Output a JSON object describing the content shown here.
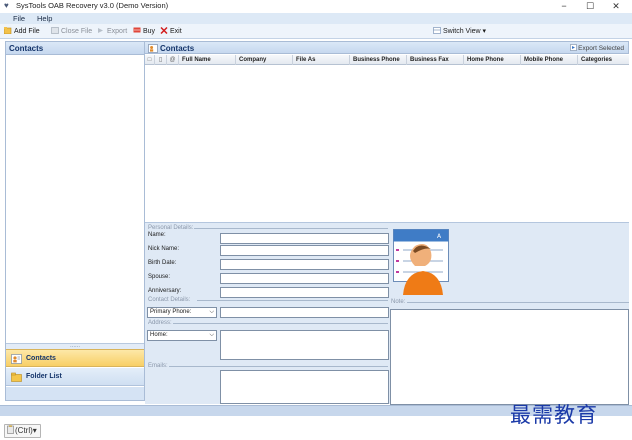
{
  "window": {
    "title": "SysTools OAB Recovery v3.0 (Demo Version)",
    "app_icon": "heart-icon",
    "minimize": "−",
    "maximize": "☐",
    "close": "✕"
  },
  "menu": [
    "File",
    "Help"
  ],
  "toolbar": {
    "add_file": "Add File",
    "close_file": "Close File",
    "export": "Export",
    "buy": "Buy",
    "exit": "Exit",
    "switch_view": "Switch View"
  },
  "left_panel": {
    "title": "Contacts",
    "splitter": "......",
    "nav": [
      {
        "label": "Contacts",
        "icon": "contacts-icon",
        "selected": true
      },
      {
        "label": "Folder List",
        "icon": "folder-icon",
        "selected": false
      }
    ]
  },
  "main": {
    "title": "Contacts",
    "export_selected": "Export Selected",
    "columns": [
      "Full Name",
      "Company",
      "File As",
      "Business Phone",
      "Business Fax",
      "Home Phone",
      "Mobile Phone",
      "Categories"
    ]
  },
  "details": {
    "personal_group": "Personal Details:",
    "personal_fields": [
      "Name:",
      "Nick Name:",
      "Birth Date:",
      "Spouse:",
      "Anniversary:"
    ],
    "contact_group": "Contact Details:",
    "phone_select": "Primary Phone:",
    "address_group": "Address:",
    "address_select": "Home:",
    "emails_group": "Emails:",
    "note_group": "Note:"
  },
  "watermark": "最需教育",
  "paste_options": "(Ctrl)▾",
  "colors": {
    "panel_header": "#c6d8ef",
    "details_bg": "#dfe9f5",
    "nav_selected": "#f8cf66",
    "watermark": "#1b3aa8"
  }
}
